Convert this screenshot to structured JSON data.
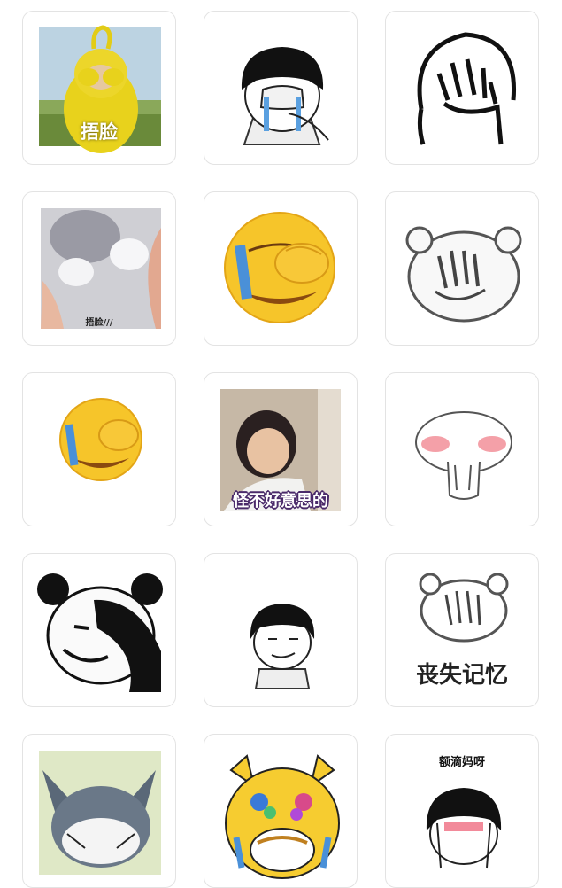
{
  "stickers": [
    {
      "name": "teletubby-cover-face",
      "caption": "捂脸"
    },
    {
      "name": "bowlcut-crying-cover-face",
      "caption": ""
    },
    {
      "name": "lineart-facepalm",
      "caption": ""
    },
    {
      "name": "cat-paws-cover",
      "caption": "捂脸///"
    },
    {
      "name": "emoji-facepalm-large",
      "caption": ""
    },
    {
      "name": "sketch-bear-facepalm",
      "caption": ""
    },
    {
      "name": "emoji-facepalm-small",
      "caption": ""
    },
    {
      "name": "girl-shy-photo",
      "caption": "怪不好意思的"
    },
    {
      "name": "blushing-mushroom",
      "caption": ""
    },
    {
      "name": "panda-facepalm",
      "caption": ""
    },
    {
      "name": "bowlcut-smirk",
      "caption": ""
    },
    {
      "name": "bear-lost-memory",
      "caption": "丧失记忆"
    },
    {
      "name": "tom-cat-covering-mouth",
      "caption": ""
    },
    {
      "name": "yellow-cat-gem-eyes",
      "caption": ""
    },
    {
      "name": "bowlcut-blush-top-text",
      "caption": "额滴妈呀"
    }
  ]
}
